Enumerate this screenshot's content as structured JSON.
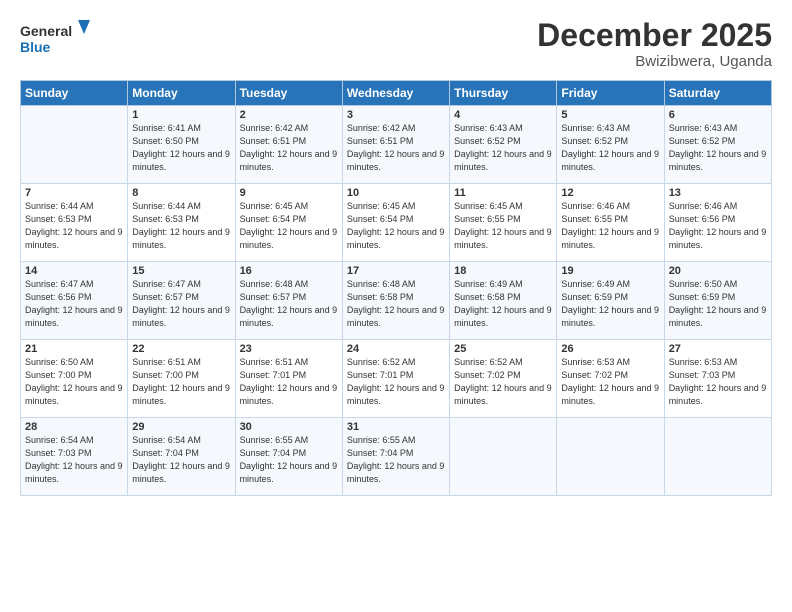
{
  "header": {
    "logo_line1": "General",
    "logo_line2": "Blue",
    "month": "December 2025",
    "location": "Bwizibwera, Uganda"
  },
  "days_of_week": [
    "Sunday",
    "Monday",
    "Tuesday",
    "Wednesday",
    "Thursday",
    "Friday",
    "Saturday"
  ],
  "weeks": [
    [
      {
        "num": "",
        "sunrise": "",
        "sunset": "",
        "daylight": ""
      },
      {
        "num": "1",
        "sunrise": "Sunrise: 6:41 AM",
        "sunset": "Sunset: 6:50 PM",
        "daylight": "Daylight: 12 hours and 9 minutes."
      },
      {
        "num": "2",
        "sunrise": "Sunrise: 6:42 AM",
        "sunset": "Sunset: 6:51 PM",
        "daylight": "Daylight: 12 hours and 9 minutes."
      },
      {
        "num": "3",
        "sunrise": "Sunrise: 6:42 AM",
        "sunset": "Sunset: 6:51 PM",
        "daylight": "Daylight: 12 hours and 9 minutes."
      },
      {
        "num": "4",
        "sunrise": "Sunrise: 6:43 AM",
        "sunset": "Sunset: 6:52 PM",
        "daylight": "Daylight: 12 hours and 9 minutes."
      },
      {
        "num": "5",
        "sunrise": "Sunrise: 6:43 AM",
        "sunset": "Sunset: 6:52 PM",
        "daylight": "Daylight: 12 hours and 9 minutes."
      },
      {
        "num": "6",
        "sunrise": "Sunrise: 6:43 AM",
        "sunset": "Sunset: 6:52 PM",
        "daylight": "Daylight: 12 hours and 9 minutes."
      }
    ],
    [
      {
        "num": "7",
        "sunrise": "Sunrise: 6:44 AM",
        "sunset": "Sunset: 6:53 PM",
        "daylight": "Daylight: 12 hours and 9 minutes."
      },
      {
        "num": "8",
        "sunrise": "Sunrise: 6:44 AM",
        "sunset": "Sunset: 6:53 PM",
        "daylight": "Daylight: 12 hours and 9 minutes."
      },
      {
        "num": "9",
        "sunrise": "Sunrise: 6:45 AM",
        "sunset": "Sunset: 6:54 PM",
        "daylight": "Daylight: 12 hours and 9 minutes."
      },
      {
        "num": "10",
        "sunrise": "Sunrise: 6:45 AM",
        "sunset": "Sunset: 6:54 PM",
        "daylight": "Daylight: 12 hours and 9 minutes."
      },
      {
        "num": "11",
        "sunrise": "Sunrise: 6:45 AM",
        "sunset": "Sunset: 6:55 PM",
        "daylight": "Daylight: 12 hours and 9 minutes."
      },
      {
        "num": "12",
        "sunrise": "Sunrise: 6:46 AM",
        "sunset": "Sunset: 6:55 PM",
        "daylight": "Daylight: 12 hours and 9 minutes."
      },
      {
        "num": "13",
        "sunrise": "Sunrise: 6:46 AM",
        "sunset": "Sunset: 6:56 PM",
        "daylight": "Daylight: 12 hours and 9 minutes."
      }
    ],
    [
      {
        "num": "14",
        "sunrise": "Sunrise: 6:47 AM",
        "sunset": "Sunset: 6:56 PM",
        "daylight": "Daylight: 12 hours and 9 minutes."
      },
      {
        "num": "15",
        "sunrise": "Sunrise: 6:47 AM",
        "sunset": "Sunset: 6:57 PM",
        "daylight": "Daylight: 12 hours and 9 minutes."
      },
      {
        "num": "16",
        "sunrise": "Sunrise: 6:48 AM",
        "sunset": "Sunset: 6:57 PM",
        "daylight": "Daylight: 12 hours and 9 minutes."
      },
      {
        "num": "17",
        "sunrise": "Sunrise: 6:48 AM",
        "sunset": "Sunset: 6:58 PM",
        "daylight": "Daylight: 12 hours and 9 minutes."
      },
      {
        "num": "18",
        "sunrise": "Sunrise: 6:49 AM",
        "sunset": "Sunset: 6:58 PM",
        "daylight": "Daylight: 12 hours and 9 minutes."
      },
      {
        "num": "19",
        "sunrise": "Sunrise: 6:49 AM",
        "sunset": "Sunset: 6:59 PM",
        "daylight": "Daylight: 12 hours and 9 minutes."
      },
      {
        "num": "20",
        "sunrise": "Sunrise: 6:50 AM",
        "sunset": "Sunset: 6:59 PM",
        "daylight": "Daylight: 12 hours and 9 minutes."
      }
    ],
    [
      {
        "num": "21",
        "sunrise": "Sunrise: 6:50 AM",
        "sunset": "Sunset: 7:00 PM",
        "daylight": "Daylight: 12 hours and 9 minutes."
      },
      {
        "num": "22",
        "sunrise": "Sunrise: 6:51 AM",
        "sunset": "Sunset: 7:00 PM",
        "daylight": "Daylight: 12 hours and 9 minutes."
      },
      {
        "num": "23",
        "sunrise": "Sunrise: 6:51 AM",
        "sunset": "Sunset: 7:01 PM",
        "daylight": "Daylight: 12 hours and 9 minutes."
      },
      {
        "num": "24",
        "sunrise": "Sunrise: 6:52 AM",
        "sunset": "Sunset: 7:01 PM",
        "daylight": "Daylight: 12 hours and 9 minutes."
      },
      {
        "num": "25",
        "sunrise": "Sunrise: 6:52 AM",
        "sunset": "Sunset: 7:02 PM",
        "daylight": "Daylight: 12 hours and 9 minutes."
      },
      {
        "num": "26",
        "sunrise": "Sunrise: 6:53 AM",
        "sunset": "Sunset: 7:02 PM",
        "daylight": "Daylight: 12 hours and 9 minutes."
      },
      {
        "num": "27",
        "sunrise": "Sunrise: 6:53 AM",
        "sunset": "Sunset: 7:03 PM",
        "daylight": "Daylight: 12 hours and 9 minutes."
      }
    ],
    [
      {
        "num": "28",
        "sunrise": "Sunrise: 6:54 AM",
        "sunset": "Sunset: 7:03 PM",
        "daylight": "Daylight: 12 hours and 9 minutes."
      },
      {
        "num": "29",
        "sunrise": "Sunrise: 6:54 AM",
        "sunset": "Sunset: 7:04 PM",
        "daylight": "Daylight: 12 hours and 9 minutes."
      },
      {
        "num": "30",
        "sunrise": "Sunrise: 6:55 AM",
        "sunset": "Sunset: 7:04 PM",
        "daylight": "Daylight: 12 hours and 9 minutes."
      },
      {
        "num": "31",
        "sunrise": "Sunrise: 6:55 AM",
        "sunset": "Sunset: 7:04 PM",
        "daylight": "Daylight: 12 hours and 9 minutes."
      },
      {
        "num": "",
        "sunrise": "",
        "sunset": "",
        "daylight": ""
      },
      {
        "num": "",
        "sunrise": "",
        "sunset": "",
        "daylight": ""
      },
      {
        "num": "",
        "sunrise": "",
        "sunset": "",
        "daylight": ""
      }
    ]
  ]
}
